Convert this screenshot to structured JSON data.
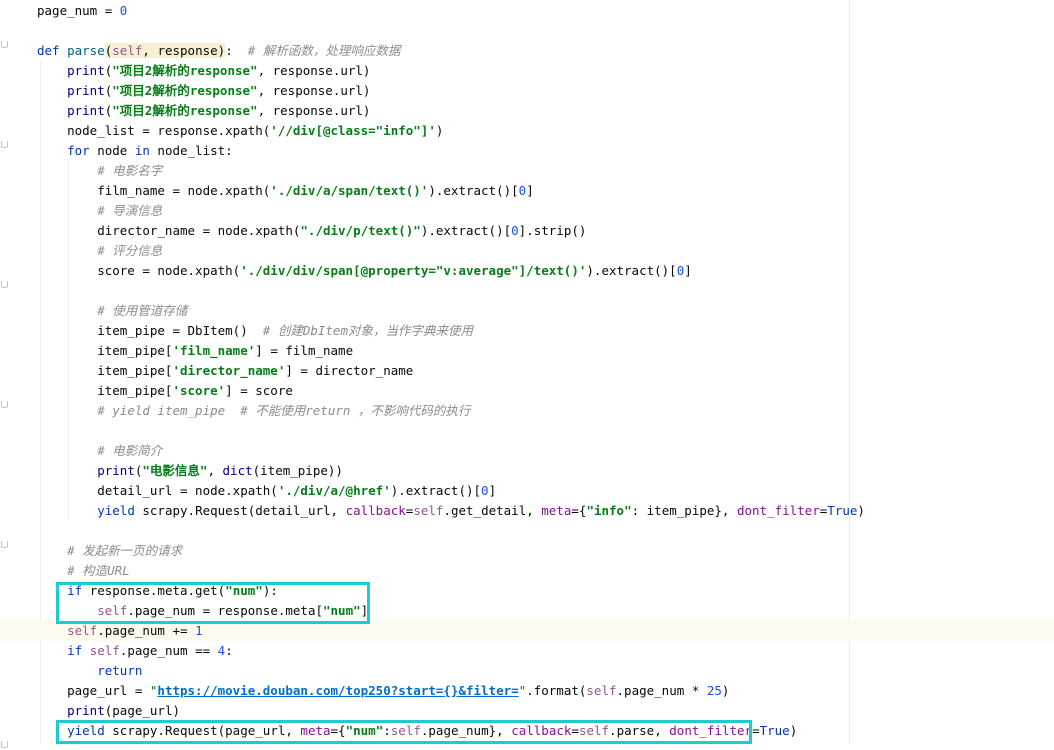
{
  "editor": {
    "language": "python",
    "lines": [
      "page_num = 0",
      "",
      "def parse(self, response):  # 解析函数，处理响应数据",
      "    print(\"项目2解析的response\", response.url)",
      "    print(\"项目2解析的response\", response.url)",
      "    print(\"项目2解析的response\", response.url)",
      "    node_list = response.xpath('//div[@class=\"info\"]')",
      "    for node in node_list:",
      "        # 电影名字",
      "        film_name = node.xpath('./div/a/span/text()').extract()[0]",
      "        # 导演信息",
      "        director_name = node.xpath(\"./div/p/text()\").extract()[0].strip()",
      "        # 评分信息",
      "        score = node.xpath('./div/div/span[@property=\"v:average\"]/text()').extract()[0]",
      "",
      "        # 使用管道存储",
      "        item_pipe = DbItem()  # 创建DbItem对象，当作字典来使用",
      "        item_pipe['film_name'] = film_name",
      "        item_pipe['director_name'] = director_name",
      "        item_pipe['score'] = score",
      "        # yield item_pipe  # 不能使用return ，不影响代码的执行",
      "",
      "        # 电影简介",
      "        print(\"电影信息\", dict(item_pipe))",
      "        detail_url = node.xpath('./div/a/@href').extract()[0]",
      "        yield scrapy.Request(detail_url, callback=self.get_detail, meta={\"info\": item_pipe}, dont_filter=True)",
      "",
      "    # 发起新一页的请求",
      "    # 构造URL",
      "    if response.meta.get(\"num\"):",
      "        self.page_num = response.meta[\"num\"]",
      "    self.page_num += 1",
      "    if self.page_num == 4:",
      "        return",
      "    page_url = \"https://movie.douban.com/top250?start={}&filter=\".format(self.page_num * 25)",
      "    print(page_url)",
      "    yield scrapy.Request(page_url, meta={\"num\":self.page_num}, callback=self.parse, dont_filter=True)"
    ],
    "current_line": 32,
    "accent_colors": {
      "highlight_box": "#1ecbcf",
      "keyword": "#0033b3",
      "string": "#067d17",
      "comment": "#8c8c8c"
    }
  }
}
